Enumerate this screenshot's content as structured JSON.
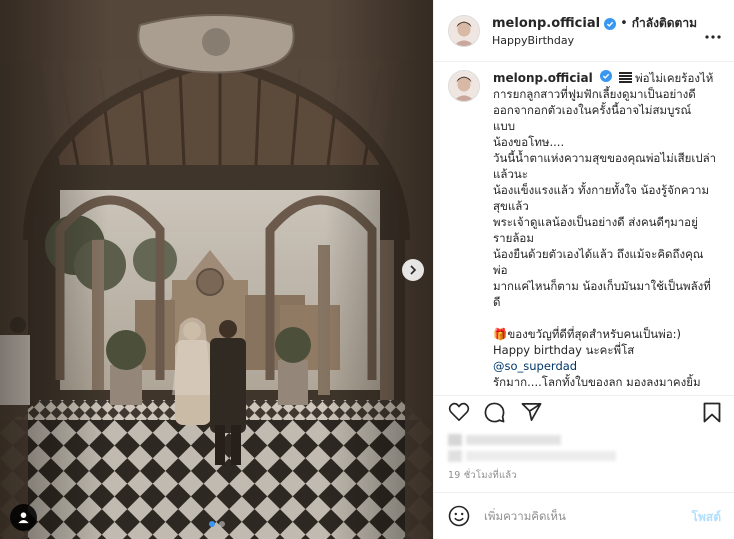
{
  "post": {
    "username": "melonp.official",
    "follow_label": "กำลังติดตาม",
    "separator": "•",
    "location": "HappyBirthday",
    "photo": {
      "alt": "Bride and father walking through a cloister archway toward a chapel",
      "carousel_dots": 2,
      "active_dot": 0
    }
  },
  "caption": {
    "username": "melonp.official",
    "lines": [
      "พ่อไม่เคยร้องไห้",
      "การยกลูกสาวที่ฟูมฟักเลี้ยงดูมาเป็นอย่างดี",
      "ออกจากอกตัวเองในครั้งนี้อาจไม่สมบูรณ์",
      "แบบ",
      "น้องขอโทษ....",
      "วันนี้น้ำตาแห่งความสุขของคุณพ่อไม่เสียเปล่า",
      "แล้วนะ",
      "น้องแข็งแรงแล้ว ทั้งกายทั้งใจ น้องรู้จักความ",
      "สุขแล้ว",
      "พระเจ้าดูแลน้องเป็นอย่างดี ส่งคนดีๆมาอยู่",
      "รายล้อม",
      "น้องยืนด้วยตัวเองได้แล้ว ถึงแม้จะคิดถึงคุณ",
      "พ่อ",
      "มากแค่ไหนก็ตาม น้องเก็บมันมาใช้เป็นพลังที่",
      "ดี"
    ],
    "gift_line": "ของขวัญที่ดีที่สุดสำหรับคนเป็นพ่อ:)",
    "birthday_line": "Happy birthday นะคะพี่โส",
    "mention": "@so_superdad",
    "last_line": "รักมาก....โลกทั้งใบของลก มองลงมาคงยิ้ม"
  },
  "actions": {
    "like_icon": "heart-icon",
    "comment_icon": "comment-icon",
    "share_icon": "share-icon",
    "save_icon": "bookmark-icon"
  },
  "timestamp": "19 ชั่วโมงที่แล้ว",
  "comment_box": {
    "placeholder": "เพิ่มความคิดเห็น",
    "post_label": "โพสต์",
    "emoji_icon": "emoji-icon"
  },
  "colors": {
    "verified": "#3897f0",
    "link": "#00376b",
    "post_disabled": "#b2dffc",
    "border": "#efefef"
  }
}
